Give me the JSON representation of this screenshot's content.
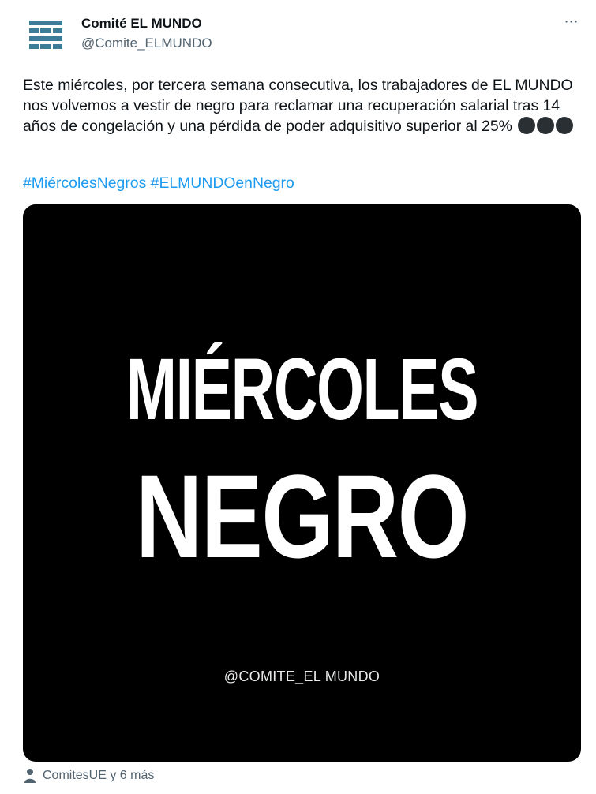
{
  "author": {
    "name": "Comité EL MUNDO",
    "handle": "@Comite_ELMUNDO"
  },
  "more_icon": "⋯",
  "tweet": {
    "text": "Este miércoles, por tercera semana consecutiva, los trabajadores de EL MUNDO nos volvemos a vestir de negro para reclamar una recuperación salarial tras 14 años de congelación y una pérdida de poder adquisitivo superior al 25%",
    "emoji_icon": "black-circle",
    "emoji_count": 3,
    "hashtags": [
      "#MiércolesNegros",
      "#ELMUNDOenNegro"
    ]
  },
  "media": {
    "line1": "MIÉRCOLES",
    "line2": "NEGRO",
    "credit": "@COMITE_EL MUNDO"
  },
  "footer": {
    "icon": "person-icon",
    "text": "ComitesUE y 6 más"
  },
  "colors": {
    "accent": "#1d9bf0",
    "avatar": "#3d7d97",
    "muted": "#536471"
  }
}
